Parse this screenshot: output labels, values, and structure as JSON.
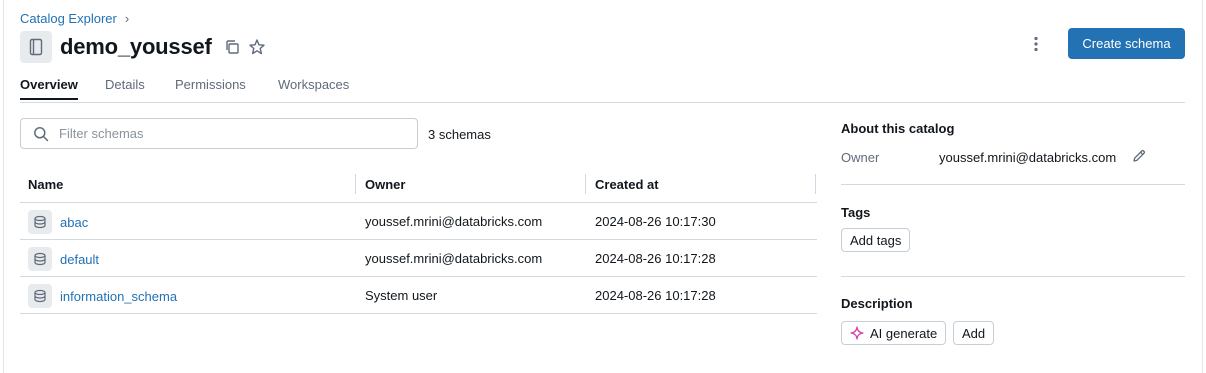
{
  "breadcrumb": {
    "catalog_explorer": "Catalog Explorer",
    "separator": "›"
  },
  "header": {
    "title": "demo_youssef",
    "primary_action": "Create schema",
    "icons": [
      "catalog-icon",
      "copy-icon",
      "star-icon",
      "kebab-menu-icon"
    ]
  },
  "tabs": [
    {
      "label": "Overview",
      "active": true
    },
    {
      "label": "Details",
      "active": false
    },
    {
      "label": "Permissions",
      "active": false
    },
    {
      "label": "Workspaces",
      "active": false
    }
  ],
  "filter": {
    "placeholder": "Filter schemas",
    "count": "3 schemas"
  },
  "table": {
    "columns": [
      "Name",
      "Owner",
      "Created at"
    ],
    "rows": [
      {
        "name": "abac",
        "owner": "youssef.mrini@databricks.com",
        "created": "2024-08-26 10:17:30"
      },
      {
        "name": "default",
        "owner": "youssef.mrini@databricks.com",
        "created": "2024-08-26 10:17:28"
      },
      {
        "name": "information_schema",
        "owner": "System user",
        "created": "2024-08-26 10:17:28"
      }
    ]
  },
  "sidebar": {
    "about": {
      "heading": "About this catalog",
      "owner_label": "Owner",
      "owner_value": "youssef.mrini@databricks.com"
    },
    "tags": {
      "heading": "Tags",
      "add_label": "Add tags"
    },
    "description": {
      "heading": "Description",
      "ai_label": "AI generate",
      "add_label": "Add"
    }
  },
  "colors": {
    "accent": "#2272b4",
    "border": "#d1d9e1",
    "muted": "#5f6b7a",
    "ai_spark": "#d63fa6"
  }
}
